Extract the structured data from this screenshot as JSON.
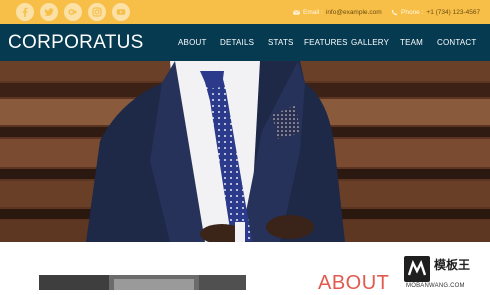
{
  "topbar": {
    "social_icons": [
      "facebook-icon",
      "twitter-icon",
      "google-plus-icon",
      "instagram-icon",
      "youtube-icon"
    ],
    "email_label": "Email :",
    "email_value": "info@example.com",
    "phone_label": "Phone :",
    "phone_value": "+1 (734) 123-4567"
  },
  "nav": {
    "logo": "CORPORATUS",
    "items": [
      "ABOUT",
      "DETAILS",
      "STATS",
      "FEATURES",
      "GALLERY",
      "TEAM",
      "CONTACT"
    ]
  },
  "about": {
    "heading": "ABOUT"
  },
  "watermark": {
    "title": "模板王",
    "url": "MOBANWANG.COM"
  },
  "colors": {
    "topbar": "#f7bf48",
    "navbar": "#063a51",
    "accent": "#e05a4e"
  }
}
